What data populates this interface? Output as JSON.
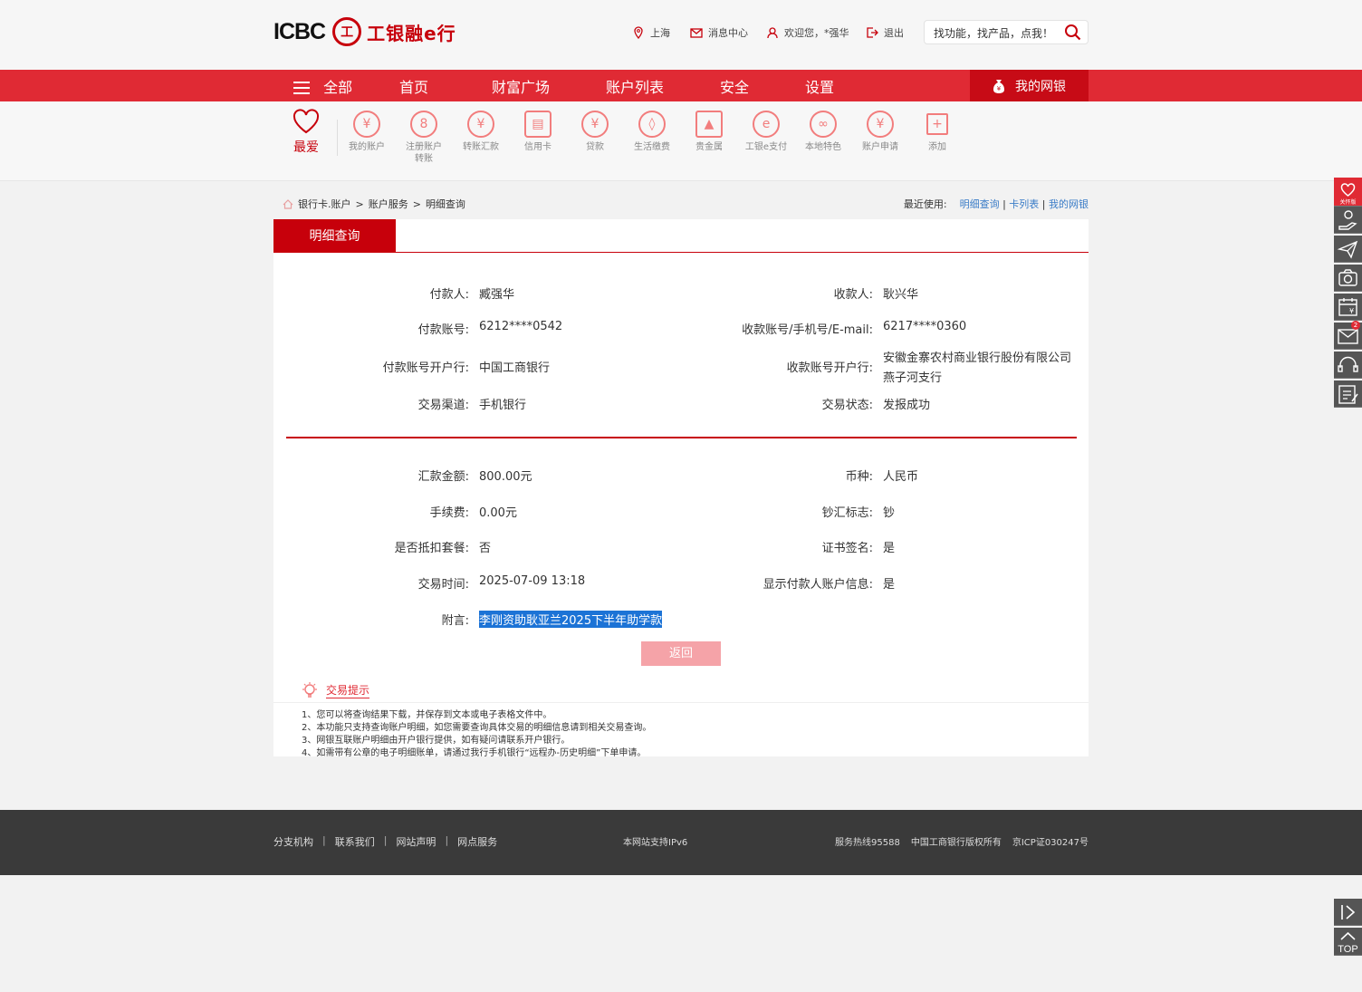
{
  "header": {
    "logo_icbc": "ICBC",
    "logo_mark": "工",
    "logo_text": "工银融e行",
    "location": "上海",
    "messages": "消息中心",
    "welcome": "欢迎您，*强华",
    "logout": "退出",
    "search_placeholder": "找功能，找产品，点我！"
  },
  "nav": {
    "all": "全部",
    "items": [
      "首页",
      "财富广场",
      "账户列表",
      "安全",
      "设置"
    ],
    "my_bank": "我的网银"
  },
  "quick": {
    "favorite": "最爱",
    "items": [
      {
        "label": "我的账户",
        "icon": "yen-icon"
      },
      {
        "label": "注册账户转账",
        "icon": "transfer-icon"
      },
      {
        "label": "转账汇款",
        "icon": "remit-icon"
      },
      {
        "label": "信用卡",
        "icon": "card-icon"
      },
      {
        "label": "贷款",
        "icon": "loan-icon"
      },
      {
        "label": "生活缴费",
        "icon": "drop-icon"
      },
      {
        "label": "贵金属",
        "icon": "gold-icon"
      },
      {
        "label": "工银e支付",
        "icon": "epay-icon"
      },
      {
        "label": "本地特色",
        "icon": "local-icon"
      },
      {
        "label": "账户申请",
        "icon": "apply-icon"
      },
      {
        "label": "添加",
        "icon": "add-icon"
      }
    ]
  },
  "breadcrumb": {
    "items": [
      "银行卡.账户",
      "账户服务",
      "明细查询"
    ],
    "sep": ">",
    "recent_label": "最近使用:",
    "recent": [
      "明细查询",
      "卡列表",
      "我的网银"
    ]
  },
  "tab": "明细查询",
  "detail": {
    "payer_label": "付款人:",
    "payer": "臧强华",
    "payee_label": "收款人:",
    "payee": "耿兴华",
    "payer_acct_label": "付款账号:",
    "payer_acct": "6212****0542",
    "payee_acct_label": "收款账号/手机号/E-mail:",
    "payee_acct": "6217****0360",
    "payer_bank_label": "付款账号开户行:",
    "payer_bank": "中国工商银行",
    "payee_bank_label": "收款账号开户行:",
    "payee_bank_1": "安徽金寨农村商业银行股份有限公司",
    "payee_bank_2": "燕子河支行",
    "channel_label": "交易渠道:",
    "channel": "手机银行",
    "status_label": "交易状态:",
    "status": "发报成功",
    "amount_label": "汇款金额:",
    "amount": "800.00元",
    "currency_label": "币种:",
    "currency": "人民币",
    "fee_label": "手续费:",
    "fee": "0.00元",
    "cash_label": "钞汇标志:",
    "cash": "钞",
    "package_label": "是否抵扣套餐:",
    "package": "否",
    "cert_label": "证书签名:",
    "cert": "是",
    "time_label": "交易时间:",
    "time": "2025-07-09 13:18",
    "show_payer_label": "显示付款人账户信息:",
    "show_payer": "是",
    "note_label": "附言:",
    "note": "李刚资助耿亚兰2025下半年助学款"
  },
  "back_button": "返回",
  "tips": {
    "title": "交易提示",
    "items": [
      "1、您可以将查询结果下载，并保存到文本或电子表格文件中。",
      "2、本功能只支持查询账户明细，如您需要查询具体交易的明细信息请到相关交易查询。",
      "3、网银互联账户明细由开户银行提供，如有疑问请联系开户银行。",
      "4、如需带有公章的电子明细账单，请通过我行手机银行“远程办-历史明细”下单申请。"
    ]
  },
  "footer": {
    "links": [
      "分支机构",
      "联系我们",
      "网站声明",
      "网点服务"
    ],
    "sep": "|",
    "ipv6": "本网站支持IPv6",
    "hotline": "服务热线95588",
    "copyright": "中国工商银行版权所有",
    "icp": "京ICP证030247号"
  },
  "side": {
    "care_label": "关怀版",
    "mail_badge": "2",
    "top_label": "TOP"
  },
  "colors": {
    "brand": "#c7000b",
    "nav": "#e02a34",
    "link": "#3a7cc7",
    "selection": "#1c73d6"
  }
}
